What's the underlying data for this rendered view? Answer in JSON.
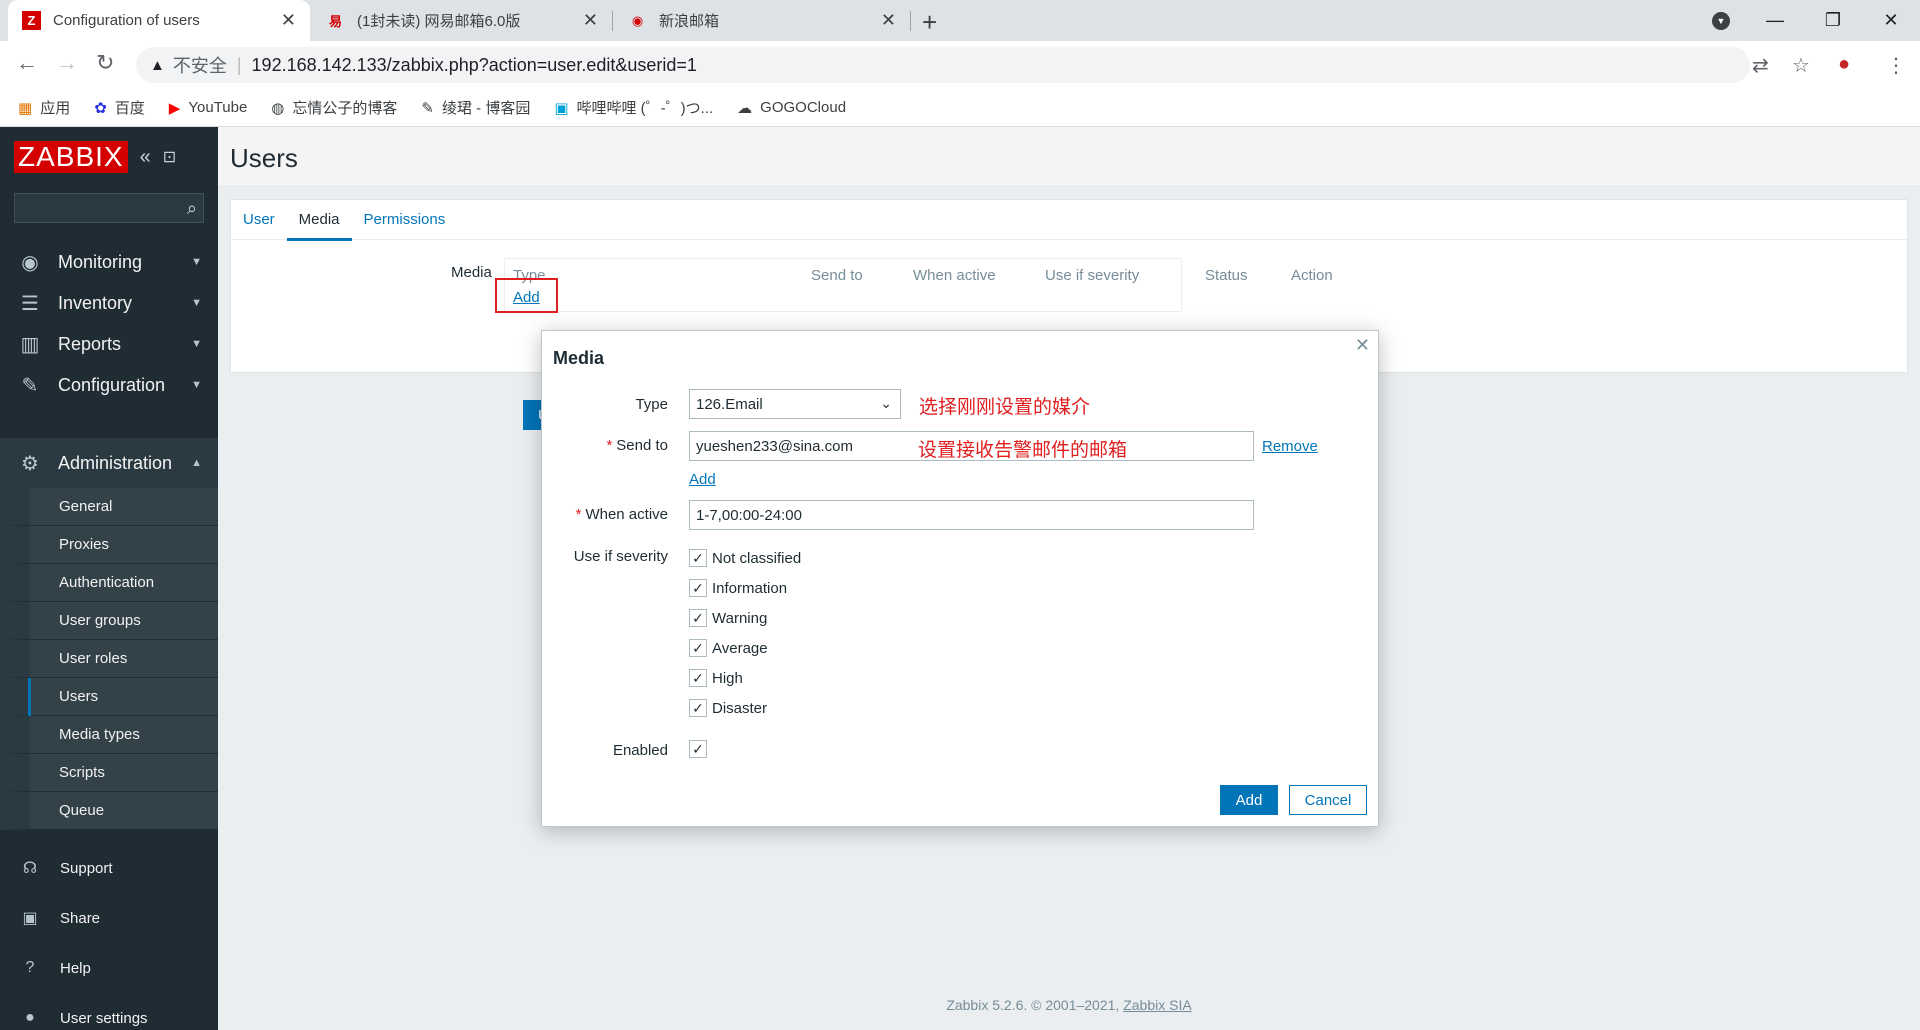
{
  "browser": {
    "tabs": [
      {
        "title": "Configuration of users",
        "favicon": "Z"
      },
      {
        "title": "(1封未读) 网易邮箱6.0版",
        "favicon": "易"
      },
      {
        "title": "新浪邮箱",
        "favicon": "◉"
      }
    ],
    "new_tab": "+",
    "address": {
      "security": "不安全",
      "url": "192.168.142.133/zabbix.php?action=user.edit&userid=1"
    },
    "bookmarks": [
      {
        "label": "应用",
        "icon": "apps-icon"
      },
      {
        "label": "百度",
        "icon": "baidu-icon"
      },
      {
        "label": "YouTube",
        "icon": "youtube-icon"
      },
      {
        "label": "忘情公子的博客",
        "icon": "globe-icon"
      },
      {
        "label": "绫珺 - 博客园",
        "icon": "blog-icon"
      },
      {
        "label": "哔哩哔哩 (゜-゜)つ...",
        "icon": "bilibili-icon"
      },
      {
        "label": "GOGOCloud",
        "icon": "gogocloud-icon"
      }
    ]
  },
  "sidebar": {
    "logo": "ZABBIX",
    "menu": [
      {
        "label": "Monitoring",
        "icon": "eye-icon"
      },
      {
        "label": "Inventory",
        "icon": "list-icon"
      },
      {
        "label": "Reports",
        "icon": "bar-chart-icon"
      },
      {
        "label": "Configuration",
        "icon": "wrench-icon"
      },
      {
        "label": "Administration",
        "icon": "gear-icon"
      }
    ],
    "admin_items": [
      "General",
      "Proxies",
      "Authentication",
      "User groups",
      "User roles",
      "Users",
      "Media types",
      "Scripts",
      "Queue"
    ],
    "bottom": [
      {
        "label": "Support",
        "icon": "headset-icon"
      },
      {
        "label": "Share",
        "icon": "share-icon"
      },
      {
        "label": "Help",
        "icon": "help-icon"
      },
      {
        "label": "User settings",
        "icon": "user-icon"
      }
    ]
  },
  "page": {
    "title": "Users",
    "tabs": [
      "User",
      "Media",
      "Permissions"
    ],
    "media_label": "Media",
    "media_columns": [
      "Type",
      "Send to",
      "When active",
      "Use if severity",
      "Status",
      "Action"
    ],
    "add_link": "Add",
    "update_stub": "Up",
    "footer_text": "Zabbix 5.2.6. © 2001–2021,",
    "footer_link": "Zabbix SIA"
  },
  "modal": {
    "title": "Media",
    "type_label": "Type",
    "type_value": "126.Email",
    "type_annotation": "选择刚刚设置的媒介",
    "send_to_label": "Send to",
    "send_to_value": "yueshen233@sina.com",
    "send_to_annotation": "设置接收告警邮件的邮箱",
    "remove_link": "Remove",
    "add_link": "Add",
    "when_active_label": "When active",
    "when_active_value": "1-7,00:00-24:00",
    "severity_label": "Use if severity",
    "severities": [
      {
        "label": "Not classified",
        "checked": true
      },
      {
        "label": "Information",
        "checked": true
      },
      {
        "label": "Warning",
        "checked": true
      },
      {
        "label": "Average",
        "checked": true
      },
      {
        "label": "High",
        "checked": true
      },
      {
        "label": "Disaster",
        "checked": true
      }
    ],
    "enabled_label": "Enabled",
    "enabled": true,
    "add_button": "Add",
    "cancel_button": "Cancel"
  }
}
